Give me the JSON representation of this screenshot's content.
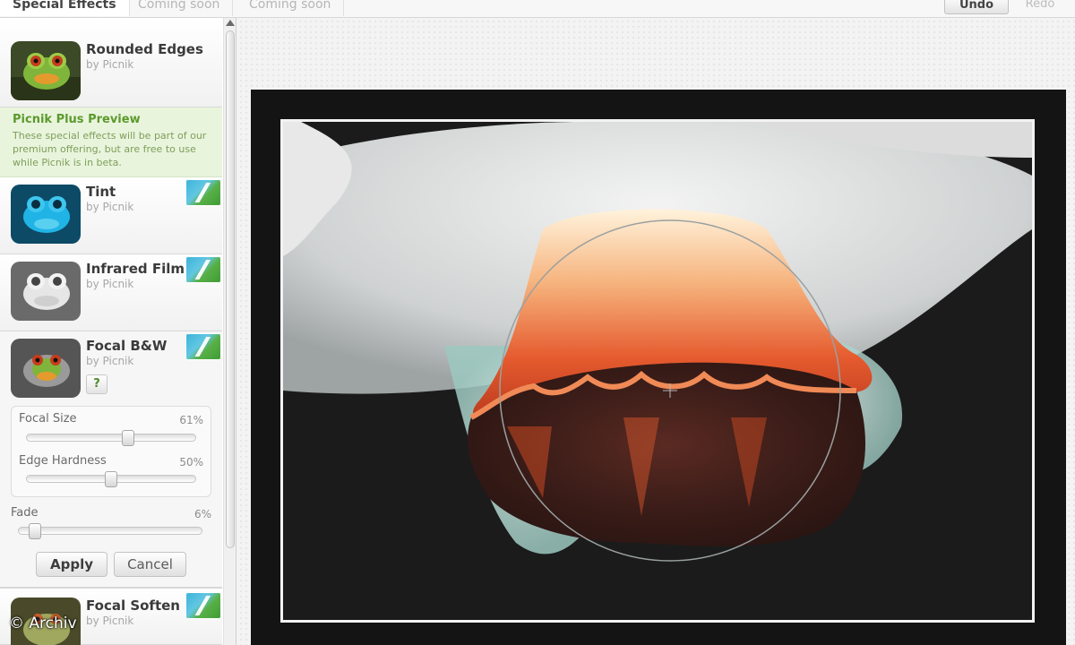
{
  "toolbar": {
    "tabs": [
      "Special Effects",
      "Coming soon",
      "Coming soon"
    ],
    "undo_label": "Undo",
    "redo_label": "Redo"
  },
  "effects": [
    {
      "title": "Rounded Edges",
      "by": "by Picnik",
      "thumb": "frog-color-thumbnail"
    },
    {
      "title": "Tint",
      "by": "by Picnik",
      "thumb": "frog-blue-tint-thumbnail"
    },
    {
      "title": "Infrared Film",
      "by": "by Picnik",
      "thumb": "frog-infrared-thumbnail"
    },
    {
      "title": "Focal B&W",
      "by": "by Picnik",
      "thumb": "frog-focal-bw-thumbnail"
    },
    {
      "title": "Focal Soften",
      "by": "by Picnik",
      "thumb": "frog-focal-soften-thumbnail"
    }
  ],
  "plus_preview": {
    "title": "Picnik Plus Preview",
    "text": "These special effects will be part of our premium offering, but are free to use while Picnik is in beta."
  },
  "help_label": "?",
  "sliders": {
    "focal_size": {
      "label": "Focal Size",
      "value_text": "61%",
      "value": 0.61
    },
    "edge_hardness": {
      "label": "Edge Hardness",
      "value_text": "50%",
      "value": 0.5
    },
    "fade": {
      "label": "Fade",
      "value_text": "6%",
      "value": 0.06
    }
  },
  "buttons": {
    "apply": "Apply",
    "cancel": "Cancel"
  },
  "copyright": "© Archiv",
  "colors": {
    "accent_green": "#5b9a2c",
    "preview_bg": "#e9f4dd",
    "canvas_bg": "#141414",
    "flower_orange": "#e8643a"
  }
}
